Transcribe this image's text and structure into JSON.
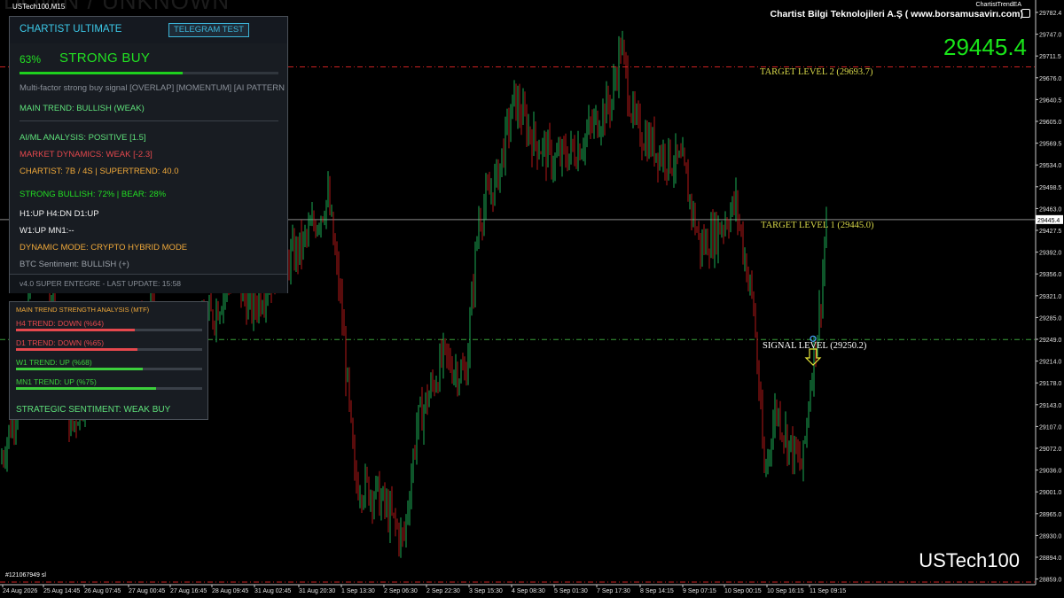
{
  "window": {
    "symbol_tf": "USTech100,M15",
    "watermark": "DOWN / UNKNOWN",
    "ea_name": "ChartistTrendEA",
    "brand": "Chartist Bilgi Teknolojileri A.Ş ( www.borsamusavirı.com)",
    "big_price": "29445.4",
    "symbol_name": "USTech100",
    "bottom_left_tag": "#121067949 sl"
  },
  "levels": {
    "target2_label": "TARGET LEVEL 2 (29693.7)",
    "target1_label": "TARGET LEVEL 1 (29445.0)",
    "signal_label": "SIGNAL LEVEL (29250.2)"
  },
  "panel": {
    "title": "CHARTIST ULTIMATE",
    "telegram_button": "TELEGRAM TEST",
    "percent": "63%",
    "signal": "STRONG BUY",
    "strength": 0.63,
    "description": "Multi-factor strong buy signal [OVERLAP] [MOMENTUM] [AI PATTERN",
    "main_trend": "MAIN TREND: BULLISH (WEAK)",
    "ai_ml": "AI/ML ANALYSIS: POSITIVE [1.5]",
    "market_dynamics": "MARKET DYNAMICS: WEAK [-2.3]",
    "chartist": "CHARTIST: 7B / 4S | SUPERTREND: 40.0",
    "bull_bear": "STRONG BULLISH: 72% | BEAR: 28%",
    "tf_line1": "H1:UP H4:DN D1:UP",
    "tf_line2": "W1:UP MN1:--",
    "dynamic_mode": "DYNAMIC MODE: CRYPTO HYBRID MODE",
    "btc_sentiment": "BTC Sentiment: BULLISH (+)",
    "footer": "v4.0 SUPER ENTEGRE - LAST UPDATE: 15:58"
  },
  "mtf": {
    "title": "MAIN TREND STRENGTH ANALYSIS (MTF)",
    "rows": [
      {
        "label": "H4 TREND: DOWN (%64)",
        "value": 0.64,
        "color": "#e5484d"
      },
      {
        "label": "D1 TREND: DOWN (%65)",
        "value": 0.65,
        "color": "#e5484d"
      },
      {
        "label": "W1 TREND: UP (%68)",
        "value": 0.68,
        "color": "#3ccf3c"
      },
      {
        "label": "MN1 TREND: UP (%75)",
        "value": 0.75,
        "color": "#3ccf3c"
      }
    ],
    "sentiment": "STRATEGIC SENTIMENT: WEAK BUY"
  },
  "price_axis": {
    "ticks": [
      "29782.4",
      "29747.0",
      "29711.5",
      "29676.0",
      "29640.5",
      "29605.0",
      "29569.5",
      "29534.0",
      "29498.5",
      "29463.0",
      "29427.5",
      "29392.0",
      "29356.0",
      "29321.0",
      "29285.0",
      "29249.0",
      "29214.0",
      "29178.0",
      "29143.0",
      "29107.0",
      "29072.0",
      "29036.0",
      "29001.0",
      "28965.0",
      "28930.0",
      "28894.0",
      "28859.0"
    ],
    "current_price_tag": "29445.4"
  },
  "time_axis": {
    "ticks": [
      "24 Aug 2026",
      "25 Aug 14:45",
      "26 Aug 07:45",
      "27 Aug 00:45",
      "27 Aug 16:45",
      "28 Aug 09:45",
      "31 Aug 02:45",
      "31 Aug 20:30",
      "1 Sep 13:30",
      "2 Sep 06:30",
      "2 Sep 22:30",
      "3 Sep 15:30",
      "4 Sep 08:30",
      "5 Sep 01:30",
      "7 Sep 17:30",
      "8 Sep 14:15",
      "9 Sep 07:15",
      "10 Sep 00:15",
      "10 Sep 16:15",
      "11 Sep 09:15"
    ]
  },
  "colors": {
    "bull": "#22d66a",
    "bear": "#e02020",
    "target_line": "#cc2222",
    "signal_line": "#3aa03a",
    "accent_green": "#22e022"
  }
}
